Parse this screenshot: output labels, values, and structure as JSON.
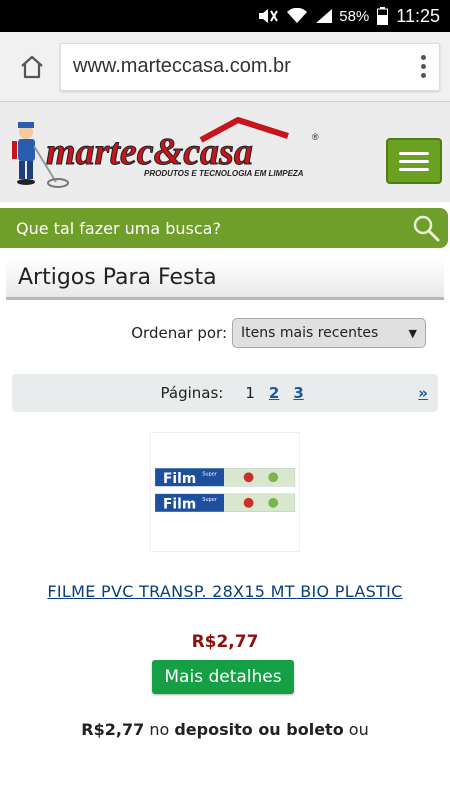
{
  "status_bar": {
    "battery": "58%",
    "time": "11:25"
  },
  "browser": {
    "url": "www.marteccasa.com.br"
  },
  "site": {
    "logo_brand": "martec&casa",
    "logo_tagline": "PRODUTOS E TECNOLOGIA EM LIMPEZA",
    "logo_registered": "®",
    "brand_color": "#c8141c",
    "accent_green": "#6f9f2a"
  },
  "search": {
    "placeholder": "Que tal fazer uma busca?"
  },
  "section": {
    "title": "Artigos Para Festa"
  },
  "sort": {
    "label": "Ordenar por:",
    "selected": "Itens mais recentes"
  },
  "pagination": {
    "label": "Páginas:",
    "pages": [
      "1",
      "2",
      "3"
    ],
    "current": "1",
    "next": "»"
  },
  "product": {
    "name": "FILME PVC TRANSP. 28X15 MT BIO PLASTIC",
    "price": "R$2,77",
    "details_button": "Mais detalhes",
    "image_text": "Film",
    "image_brand": "Super"
  },
  "payment": {
    "price": "R$2,77",
    "text_1": "no",
    "method": "deposito ou boleto",
    "text_2": "ou"
  }
}
